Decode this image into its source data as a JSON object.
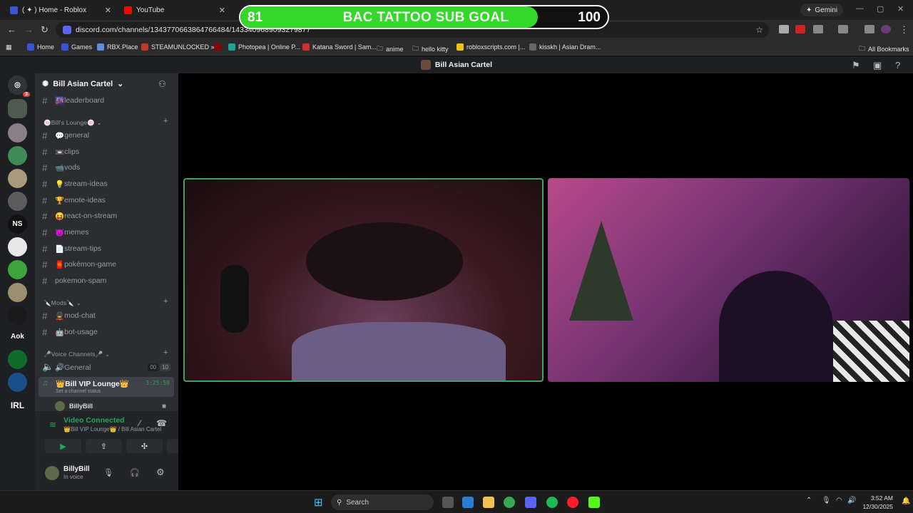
{
  "browser": {
    "tabs": [
      {
        "title": "( ✦ ) Home - Roblox",
        "color": "#3a54d4"
      },
      {
        "title": "YouTube",
        "color": "#ff0000"
      }
    ],
    "gemini_label": "Gemini",
    "url": "discord.com/channels/1343770663864766484/1433409689093279877",
    "bookmarks": [
      "Home",
      "Games",
      "RBX.Place",
      "STEAMUNLOCKED »...",
      "Photopea | Online P...",
      "Katana Sword | Sam...",
      "anime",
      "hello kitty",
      "robloxscripts.com |...",
      "kisskh | Asian Dram..."
    ],
    "all_bookmarks": "All Bookmarks"
  },
  "goal_overlay": {
    "current": "81",
    "title": "BAC TATTOO SUB GOAL",
    "target": "100",
    "progress_fraction": 0.81,
    "color": "#34d829"
  },
  "discord": {
    "window_title": "Bill Asian Cartel",
    "server_name": "Bill Asian Cartel",
    "home_badge": "3",
    "server_icons": [
      "NS",
      "Aok",
      "IRL"
    ],
    "channels_top": [
      {
        "emoji": "🌆",
        "name": "leaderboard"
      }
    ],
    "category_lounge": "🍥Bill's Lounge🍥",
    "lounge_channels": [
      {
        "emoji": "💬",
        "name": "general"
      },
      {
        "emoji": "📼",
        "name": "clips"
      },
      {
        "emoji": "📹",
        "name": "vods"
      },
      {
        "emoji": "💡",
        "name": "stream-ideas"
      },
      {
        "emoji": "🏆",
        "name": "emote-ideas"
      },
      {
        "emoji": "😝",
        "name": "react-on-stream"
      },
      {
        "emoji": "😈",
        "name": "memes"
      },
      {
        "emoji": "📄",
        "name": "stream-tips"
      },
      {
        "emoji": "🧧",
        "name": "pokémon-game"
      },
      {
        "emoji": "",
        "name": "pokemon-spam"
      }
    ],
    "category_mods": "🔪Mods🔪",
    "mod_channels": [
      {
        "emoji": "💂",
        "name": "mod-chat"
      },
      {
        "emoji": "🤖",
        "name": "bot-usage"
      }
    ],
    "category_voice": "🎤Voice Channels🎤",
    "voice_general": {
      "name": "🔊General",
      "count_a": "00",
      "count_b": "10"
    },
    "voice_vip": {
      "name": "👑Bill VIP Lounge👑",
      "time": "3:25:59",
      "status": "Set a channel status"
    },
    "voice_member": "BillyBill",
    "connection": {
      "status": "Video Connected",
      "location": "👑Bill VIP Lounge👑 / Bill Asian Cartel"
    },
    "user": {
      "name": "BillyBill",
      "status": "In voice"
    }
  },
  "taskbar": {
    "search_placeholder": "Search",
    "time": "3:52 AM",
    "date": "12/30/2025"
  }
}
